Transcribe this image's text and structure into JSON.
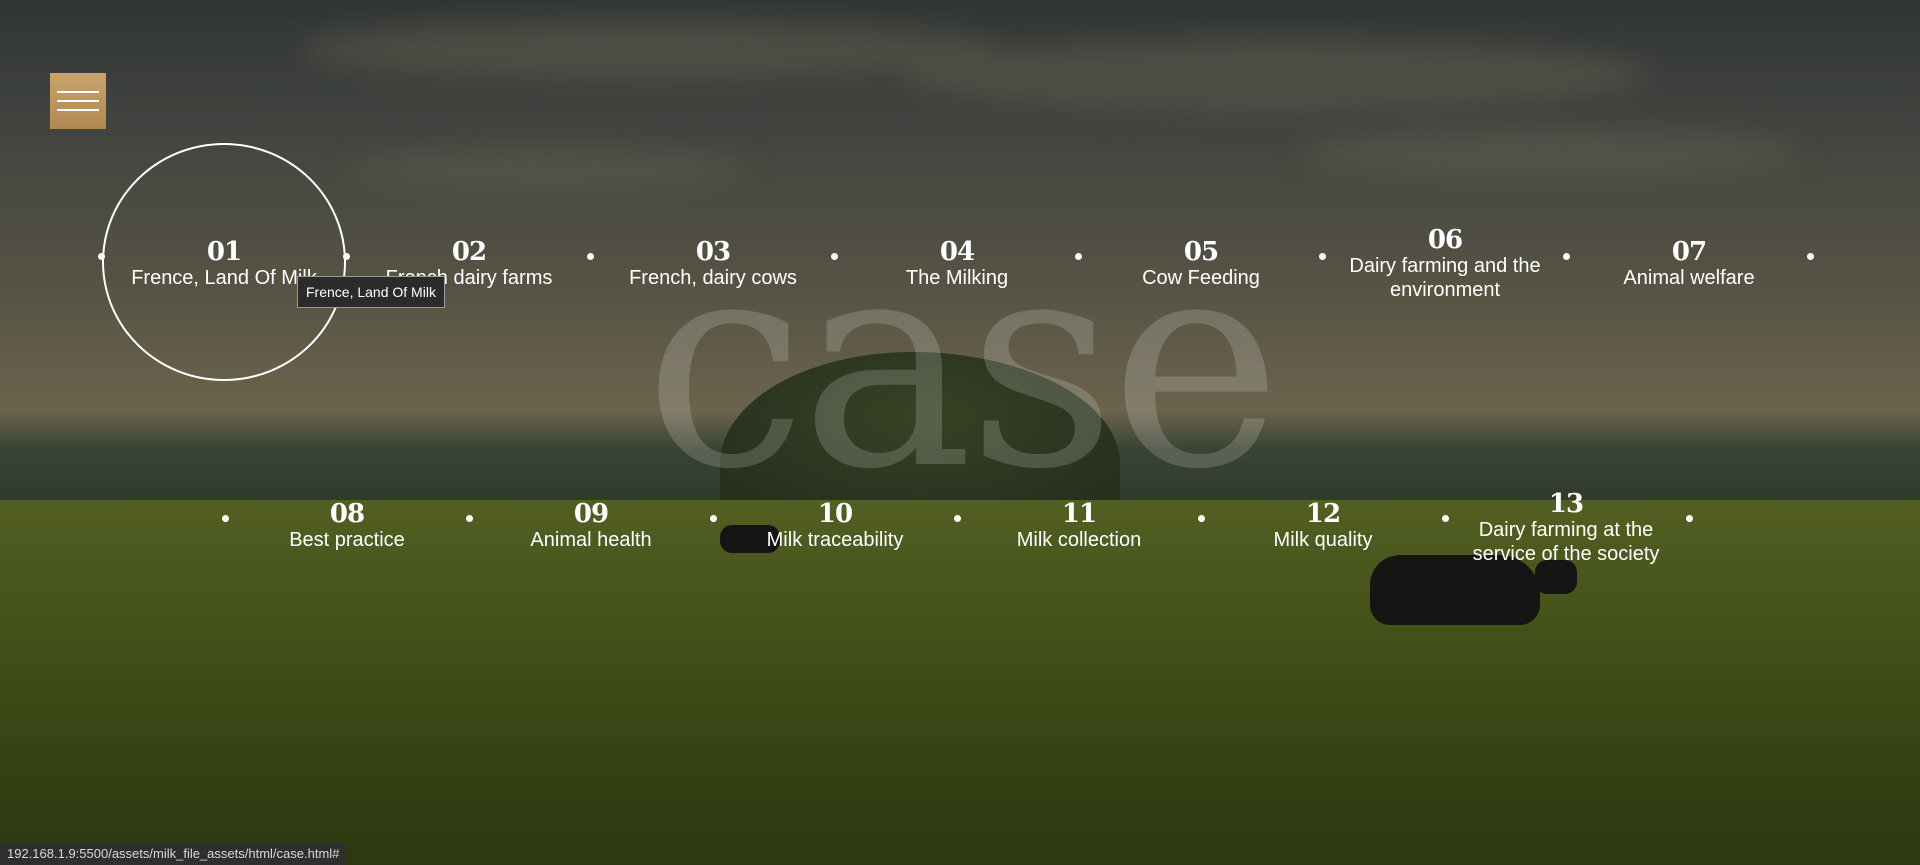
{
  "watermark": "case",
  "menu": {
    "icon": "hamburger-icon"
  },
  "timeline": {
    "row1": [
      {
        "num": "01",
        "label": "Frence, Land Of Milk",
        "active": true
      },
      {
        "num": "02",
        "label": "French dairy farms"
      },
      {
        "num": "03",
        "label": "French, dairy cows"
      },
      {
        "num": "04",
        "label": "The Milking"
      },
      {
        "num": "05",
        "label": "Cow Feeding"
      },
      {
        "num": "06",
        "label": "Dairy farming and the environment"
      },
      {
        "num": "07",
        "label": "Animal welfare"
      }
    ],
    "row2": [
      {
        "num": "08",
        "label": "Best practice"
      },
      {
        "num": "09",
        "label": "Animal health"
      },
      {
        "num": "10",
        "label": "Milk traceability"
      },
      {
        "num": "11",
        "label": "Milk collection"
      },
      {
        "num": "12",
        "label": "Milk quality"
      },
      {
        "num": "13",
        "label": "Dairy farming at the service of the society"
      }
    ]
  },
  "tooltip": "Frence, Land Of Milk",
  "status_url": "192.168.1.9:5500/assets/milk_file_assets/html/case.html#"
}
